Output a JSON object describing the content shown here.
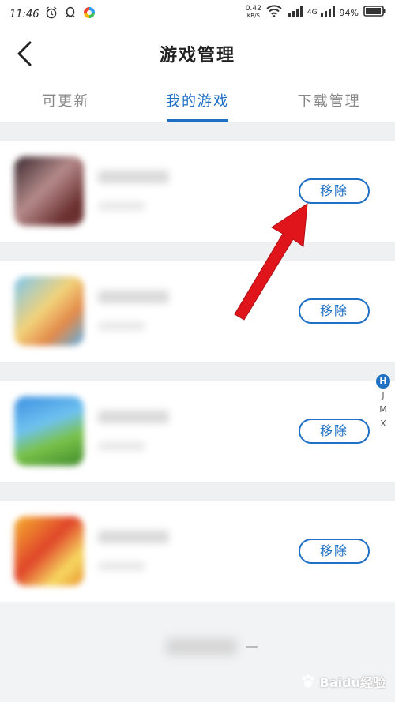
{
  "status_bar": {
    "time": "11:46",
    "speed_value": "0.42",
    "speed_unit": "KB/S",
    "network_label": "4G",
    "battery": "94%"
  },
  "header": {
    "title": "游戏管理"
  },
  "tabs": [
    {
      "label": "可更新",
      "active": false
    },
    {
      "label": "我的游戏",
      "active": true
    },
    {
      "label": "下载管理",
      "active": false
    }
  ],
  "games": [
    {
      "remove_label": "移除"
    },
    {
      "remove_label": "移除"
    },
    {
      "remove_label": "移除"
    },
    {
      "remove_label": "移除"
    }
  ],
  "index_bar": [
    "H",
    "J",
    "M",
    "X"
  ],
  "watermark": {
    "text": "Baidu经验"
  },
  "colors": {
    "accent": "#1f6fc5",
    "arrow": "#e0141b"
  }
}
